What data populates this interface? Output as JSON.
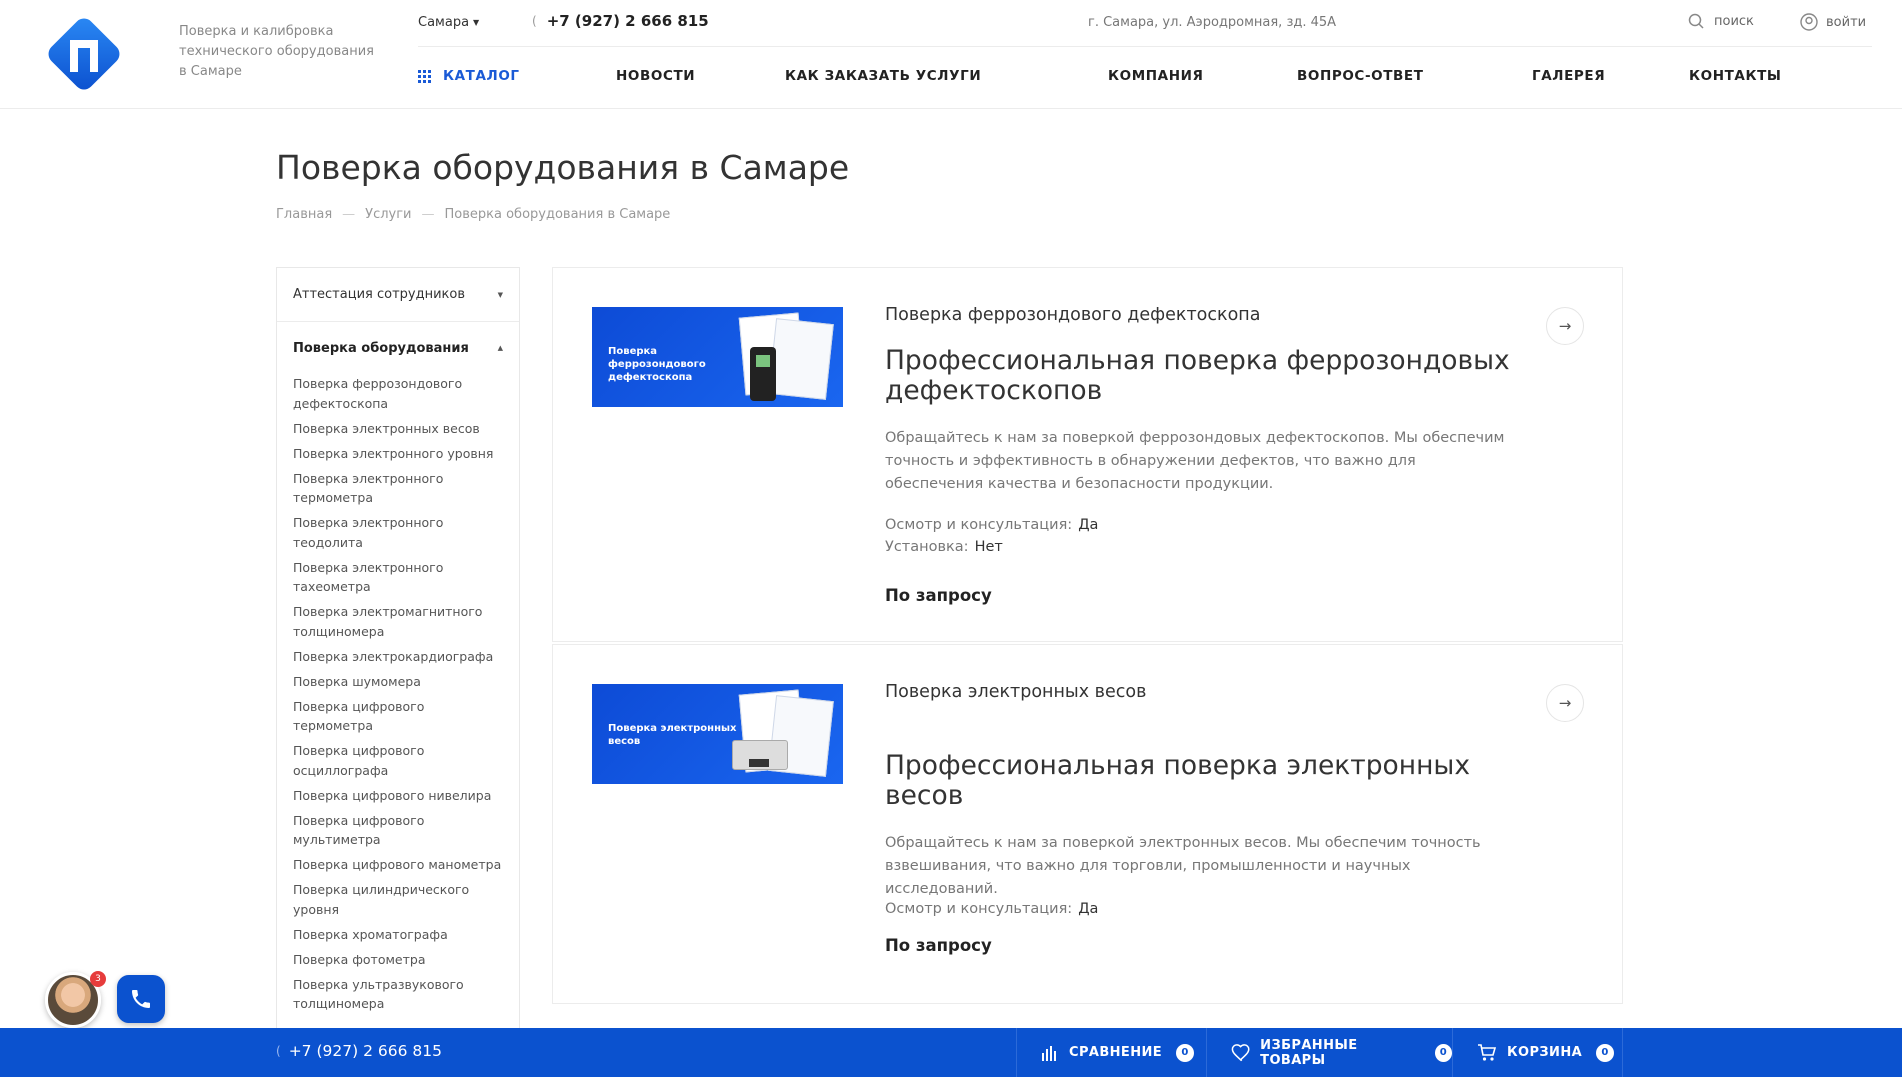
{
  "header": {
    "slogan": "Поверка и калибровка технического оборудования в Самаре",
    "city": "Самара",
    "phone": "+7 (927) 2 666 815",
    "address": "г. Самара, ул. Аэродромная, зд. 45А",
    "search_label": "поиск",
    "login_label": "войти",
    "nav": [
      "Каталог",
      "Новости",
      "Как заказать услуги",
      "Компания",
      "Вопрос-ответ",
      "Галерея",
      "Контакты"
    ]
  },
  "page": {
    "title": "Поверка оборудования в Самаре",
    "breadcrumb": [
      "Главная",
      "Услуги",
      "Поверка оборудования в Самаре"
    ]
  },
  "sidebar": {
    "sections": [
      {
        "label": "Аттестация сотрудников"
      },
      {
        "label": "Поверка оборудования"
      }
    ],
    "items": [
      "Поверка феррозондового дефектоскопа",
      "Поверка электронных весов",
      "Поверка электронного уровня",
      "Поверка электронного термометра",
      "Поверка электронного теодолита",
      "Поверка электронного тахеометра",
      "Поверка электромагнитного толщиномера",
      "Поверка электрокардиографа",
      "Поверка шумомера",
      "Поверка цифрового термометра",
      "Поверка цифрового осциллографа",
      "Поверка цифрового нивелира",
      "Поверка цифрового мультиметра",
      "Поверка цифрового манометра",
      "Поверка цилиндрического уровня",
      "Поверка хроматографа",
      "Поверка фотометра",
      "Поверка ультразвукового толщиномера"
    ]
  },
  "cards": [
    {
      "image_text": "Поверка феррозондового дефектоскопа",
      "category": "Поверка феррозондового дефектоскопа",
      "title": "Профессиональная поверка феррозондовых дефектоскопов",
      "description": "Обращайтесь к нам за поверкой феррозондовых дефектоскопов. Мы обеспечим точность и эффективность в обнаружении дефектов, что важно для обеспечения качества и безопасности продукции.",
      "props": [
        {
          "name": "Осмотр и консультация:",
          "value": "Да"
        },
        {
          "name": "Установка:",
          "value": "Нет"
        }
      ],
      "price": "По запросу"
    },
    {
      "image_text": "Поверка электронных весов",
      "category": "Поверка электронных весов",
      "title": "Профессиональная поверка электронных весов",
      "description": "Обращайтесь к нам за поверкой электронных весов. Мы обеспечим точность взвешивания, что важно для торговли, промышленности и научных исследований.",
      "props": [
        {
          "name": "Осмотр и консультация:",
          "value": "Да"
        }
      ],
      "price": "По запросу"
    }
  ],
  "bottombar": {
    "phone": "+7 (927) 2 666 815",
    "compare_label": "Сравнение",
    "compare_count": "0",
    "fav_label": "Избранные товары",
    "fav_count": "0",
    "cart_label": "Корзина",
    "cart_count": "0"
  },
  "widget": {
    "badge_count": "3"
  },
  "colors": {
    "accent": "#1a5ad6",
    "bottom_bar": "#0b52cf"
  }
}
